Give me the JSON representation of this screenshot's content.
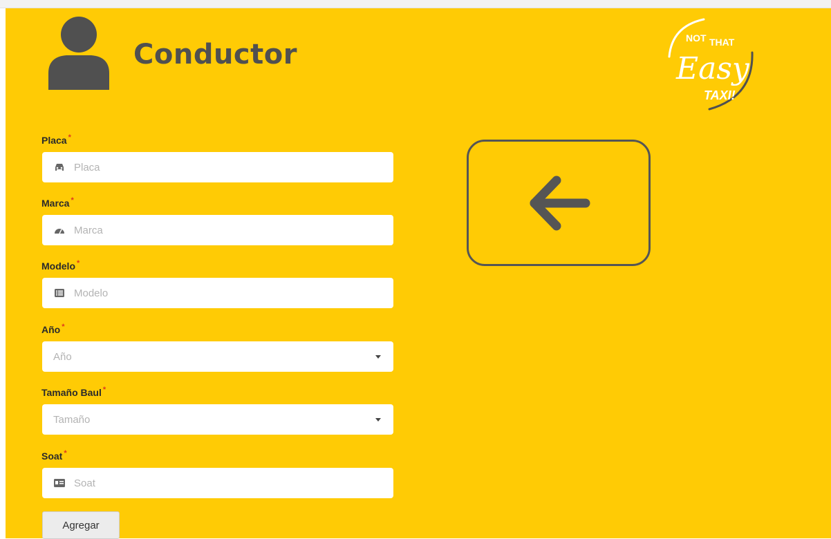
{
  "header": {
    "title": "Conductor",
    "icon": "user-icon"
  },
  "logo": {
    "line1": "NOT",
    "line2": "THAT",
    "line3": "Easy",
    "line4": "TAXI!"
  },
  "form": {
    "required_mark": "*",
    "fields": {
      "placa": {
        "label": "Placa",
        "placeholder": "Placa",
        "icon": "car-icon"
      },
      "marca": {
        "label": "Marca",
        "placeholder": "Marca",
        "icon": "gauge-icon"
      },
      "modelo": {
        "label": "Modelo",
        "placeholder": "Modelo",
        "icon": "list-icon"
      },
      "anio": {
        "label": "Año",
        "selected": "Año"
      },
      "tamano": {
        "label": "Tamaño Baul",
        "selected": "Tamaño"
      },
      "soat": {
        "label": "Soat",
        "placeholder": "Soat",
        "icon": "id-card-icon"
      }
    },
    "submit_label": "Agregar"
  },
  "back_button": {
    "icon": "arrow-left-icon"
  },
  "colors": {
    "background": "#ffcb05",
    "title": "#505050",
    "required": "#e0391e",
    "input_bg": "#ffffff",
    "placeholder": "#b3b3b3"
  }
}
